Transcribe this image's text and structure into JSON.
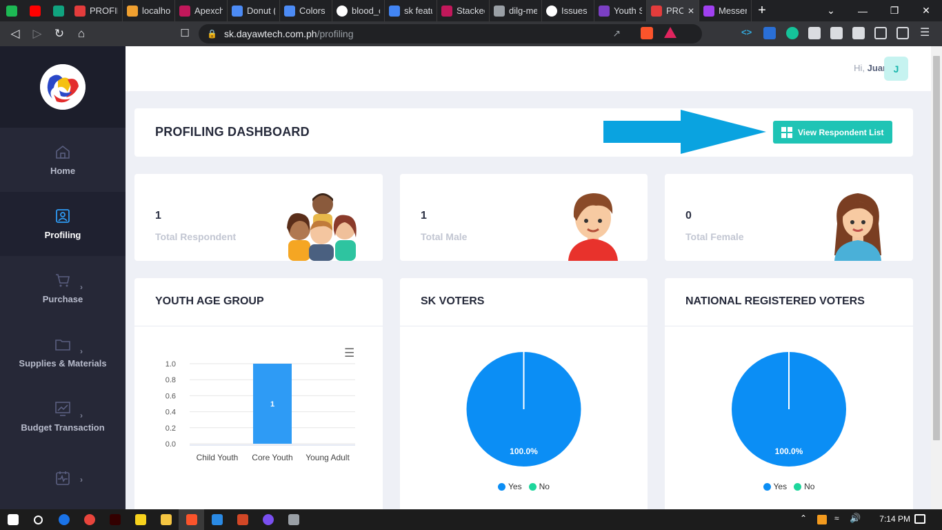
{
  "browser": {
    "tabs": [
      {
        "label": "",
        "color": "#1db954",
        "pinned": true
      },
      {
        "label": "",
        "color": "#ff0000",
        "pinned": true
      },
      {
        "label": "",
        "color": "#10a37f",
        "pinned": true
      },
      {
        "label": "PROFIL",
        "color": "#e33c3c"
      },
      {
        "label": "localho",
        "color": "#f0a030"
      },
      {
        "label": "Apexch",
        "color": "#c2185b"
      },
      {
        "label": "Donut (",
        "color": "#4c8bf5"
      },
      {
        "label": "Colors",
        "color": "#4c8bf5"
      },
      {
        "label": "blood_c",
        "color": "#ffffff"
      },
      {
        "label": "sk featu",
        "color": "#4285f4"
      },
      {
        "label": "Stacked",
        "color": "#c2185b"
      },
      {
        "label": "dilg-me",
        "color": "#9aa0a6"
      },
      {
        "label": "Issues ·",
        "color": "#ffffff"
      },
      {
        "label": "Youth S",
        "color": "#7b3fc4"
      },
      {
        "label": "PRC",
        "color": "#e33c3c",
        "active": true
      },
      {
        "label": "Messen",
        "color": "#a040f0"
      }
    ],
    "new_tab": "+",
    "url_host": "sk.dayawtech.com.ph",
    "url_path": "/profiling"
  },
  "sidebar": {
    "items": [
      {
        "label": "Home",
        "icon": "home-icon",
        "active": false,
        "chevron": false
      },
      {
        "label": "Profiling",
        "icon": "profile-card-icon",
        "active": true,
        "chevron": false
      },
      {
        "label": "Purchase",
        "icon": "cart-icon",
        "active": false,
        "chevron": true
      },
      {
        "label": "Supplies & Materials",
        "icon": "folder-icon",
        "active": false,
        "chevron": true
      },
      {
        "label": "Budget Transaction",
        "icon": "chart-board-icon",
        "active": false,
        "chevron": true
      },
      {
        "label": "",
        "icon": "calendar-pulse-icon",
        "active": false,
        "chevron": true
      }
    ]
  },
  "header": {
    "greeting": "Hi,",
    "user_name": "Juan",
    "avatar_letter": "J"
  },
  "dashboard": {
    "title": "PROFILING DASHBOARD",
    "view_button": "View Respondent List"
  },
  "stats": [
    {
      "value": "1",
      "label": "Total Respondent",
      "illustration": "family-icon"
    },
    {
      "value": "1",
      "label": "Total Male",
      "illustration": "male-avatar-icon"
    },
    {
      "value": "0",
      "label": "Total Female",
      "illustration": "female-avatar-icon"
    }
  ],
  "charts": {
    "youth_age": {
      "title": "YOUTH AGE GROUP",
      "menu_icon": "hamburger-icon"
    },
    "sk_voters": {
      "title": "SK VOTERS",
      "slice_label": "100.0%",
      "legend": [
        "Yes",
        "No"
      ]
    },
    "national_voters": {
      "title": "NATIONAL REGISTERED VOTERS",
      "slice_label": "100.0%",
      "legend": [
        "Yes",
        "No"
      ]
    }
  },
  "chart_data": [
    {
      "type": "bar",
      "title": "YOUTH AGE GROUP",
      "categories": [
        "Child Youth",
        "Core Youth",
        "Young Adult"
      ],
      "values": [
        0,
        1,
        0
      ],
      "data_labels": [
        "",
        "1",
        ""
      ],
      "yticks": [
        "0.0",
        "0.2",
        "0.4",
        "0.6",
        "0.8",
        "1.0"
      ],
      "ylim": [
        0,
        1
      ],
      "grid": true,
      "color": "#2e9bf5"
    },
    {
      "type": "pie",
      "title": "SK VOTERS",
      "categories": [
        "Yes",
        "No"
      ],
      "values": [
        100,
        0
      ],
      "colors": [
        "#0b8ef5",
        "#1ed69c"
      ],
      "legend": "bottom"
    },
    {
      "type": "pie",
      "title": "NATIONAL REGISTERED VOTERS",
      "categories": [
        "Yes",
        "No"
      ],
      "values": [
        100,
        0
      ],
      "colors": [
        "#0b8ef5",
        "#1ed69c"
      ],
      "legend": "bottom"
    }
  ],
  "taskbar": {
    "time": "7:14 PM",
    "apps": [
      "windows-start-icon",
      "search-icon",
      "maps-icon",
      "chrome-icon",
      "illustrator-icon",
      "sticky-notes-icon",
      "file-explorer-icon",
      "brave-icon",
      "vscode-icon",
      "powerpoint-icon",
      "messenger-icon",
      "paint-icon"
    ]
  },
  "colors": {
    "accent": "#1fc4b5",
    "arrow": "#0aa3e0",
    "sidebar": "#262837",
    "pie_yes": "#0b8ef5",
    "pie_no": "#1ed69c"
  }
}
